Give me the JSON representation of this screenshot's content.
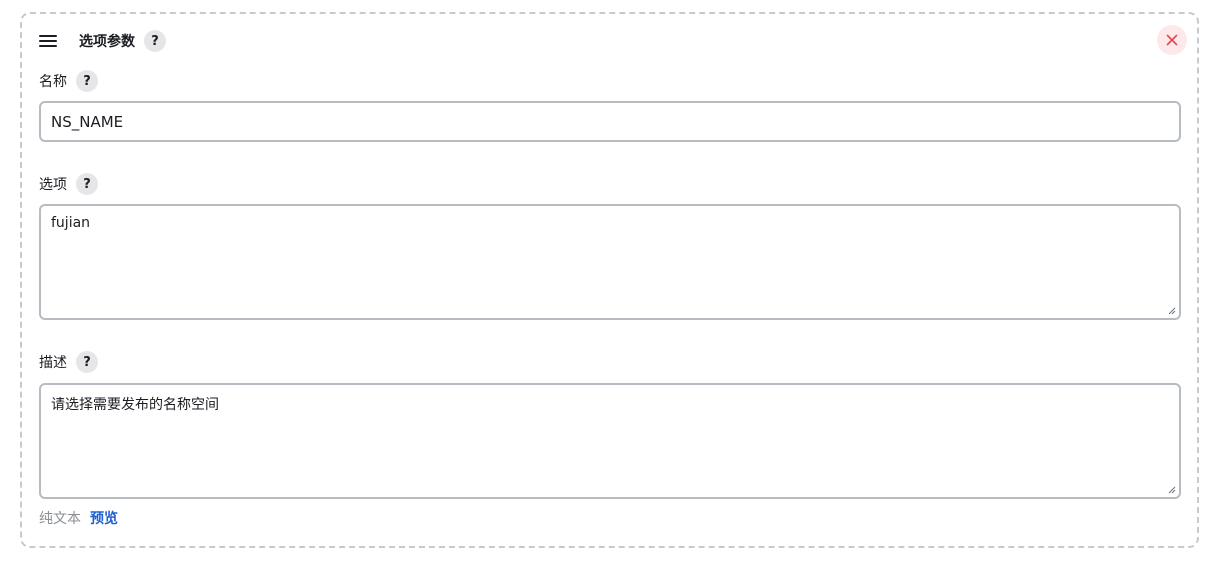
{
  "section": {
    "title": "选项参数",
    "help_label": "?"
  },
  "name_field": {
    "label": "名称",
    "help_label": "?",
    "value": "NS_NAME"
  },
  "choices_field": {
    "label": "选项",
    "help_label": "?",
    "value": "fujian"
  },
  "description_field": {
    "label": "描述",
    "help_label": "?",
    "value": "请选择需要发布的名称空间"
  },
  "footer": {
    "plain_text_label": "纯文本",
    "preview_label": "预览"
  },
  "icons": {
    "menu": "hamburger-icon",
    "close": "close-icon",
    "resize": "resize-grip-icon"
  },
  "colors": {
    "close_icon": "#e0474f",
    "close_bg": "#fde9ea",
    "link": "#1f5fcf",
    "muted_text": "#8a8d93"
  }
}
